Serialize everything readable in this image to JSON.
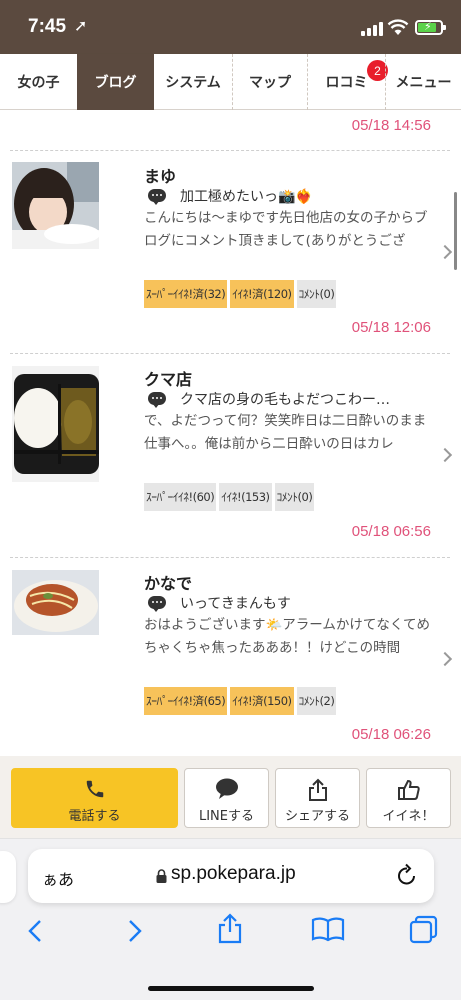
{
  "status_bar": {
    "time": "7:45"
  },
  "nav": {
    "tabs": [
      {
        "label": "女の子",
        "active": false
      },
      {
        "label": "ブログ",
        "active": true
      },
      {
        "label": "システム",
        "active": false
      },
      {
        "label": "マップ",
        "active": false
      },
      {
        "label": "ロコミ",
        "active": false,
        "badge": "2"
      },
      {
        "label": "メニュー",
        "active": false
      }
    ]
  },
  "feed": {
    "top_date": "05/18 14:56",
    "posts": [
      {
        "name": "まゆ",
        "title": "加工極めたいっ📸❤️‍🔥",
        "body": "こんにちは〜まゆです先日他店の女の子からブログにコメント頂きまして(ありがとうござ",
        "tags": [
          {
            "label": "ｽｰﾊﾟｰｲｲﾈ!済(32)",
            "active": true
          },
          {
            "label": "ｲｲﾈ!済(120)",
            "active": true
          },
          {
            "label": "ｺﾒﾝﾄ(0)",
            "active": false
          }
        ],
        "date": "05/18 12:06",
        "thumb_icon": "selfie-photo"
      },
      {
        "name": "クマ店",
        "title": "クマ店の身の毛もよだつこわー…",
        "body": "で、よだつって何？笑笑昨日は二日酔いのまま仕事へ。。俺は前から二日酔いの日はカレ",
        "tags": [
          {
            "label": "ｽｰﾊﾟｰｲｲﾈ!(60)",
            "active": false
          },
          {
            "label": "ｲｲﾈ!(153)",
            "active": false
          },
          {
            "label": "ｺﾒﾝﾄ(0)",
            "active": false
          }
        ],
        "date": "05/18 06:56",
        "thumb_icon": "curry-photo"
      },
      {
        "name": "かなで",
        "title": "いってきまんもす",
        "body": "おはようございます🌤️アラームかけてなくてめちゃくちゃ焦ったあああ！！けどこの時間",
        "tags": [
          {
            "label": "ｽｰﾊﾟｰｲｲﾈ!済(65)",
            "active": true
          },
          {
            "label": "ｲｲﾈ!済(150)",
            "active": true
          },
          {
            "label": "ｺﾒﾝﾄ(2)",
            "active": false
          }
        ],
        "date": "05/18 06:26",
        "thumb_icon": "okonomiyaki-photo"
      }
    ]
  },
  "actions": {
    "call": "電話する",
    "line": "LINEする",
    "share": "シェアする",
    "like": "イイネ！"
  },
  "browser": {
    "aa": "ぁあ",
    "url": "sp.pokepara.jp"
  },
  "colors": {
    "header_brown": "#5b4a3f",
    "date_pink": "#e0527a",
    "tag_active": "#f7c25a",
    "call_yellow": "#f7c425",
    "browser_blue": "#1a7cf5"
  }
}
